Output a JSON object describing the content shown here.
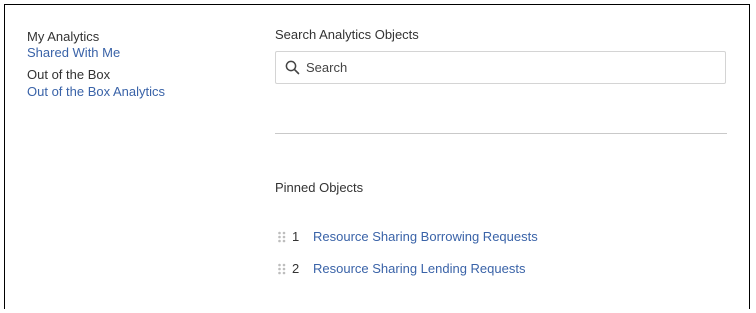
{
  "sidebar": {
    "my_analytics": "My Analytics",
    "shared_with_me": "Shared With Me",
    "out_of_the_box_heading": "Out of the Box",
    "out_of_the_box_link": "Out of the Box Analytics"
  },
  "search": {
    "label": "Search Analytics Objects",
    "placeholder": "Search",
    "icon": "search-icon"
  },
  "pinned": {
    "title": "Pinned Objects",
    "items": [
      {
        "number": "1",
        "label": "Resource Sharing Borrowing Requests",
        "icon": "drag-handle-icon"
      },
      {
        "number": "2",
        "label": "Resource Sharing Lending Requests",
        "icon": "drag-handle-icon"
      }
    ]
  },
  "colors": {
    "link": "#3a63a8",
    "text": "#333333",
    "border": "#d4d4d4",
    "divider": "#c9c9c9",
    "handle": "#bdbdbd"
  }
}
